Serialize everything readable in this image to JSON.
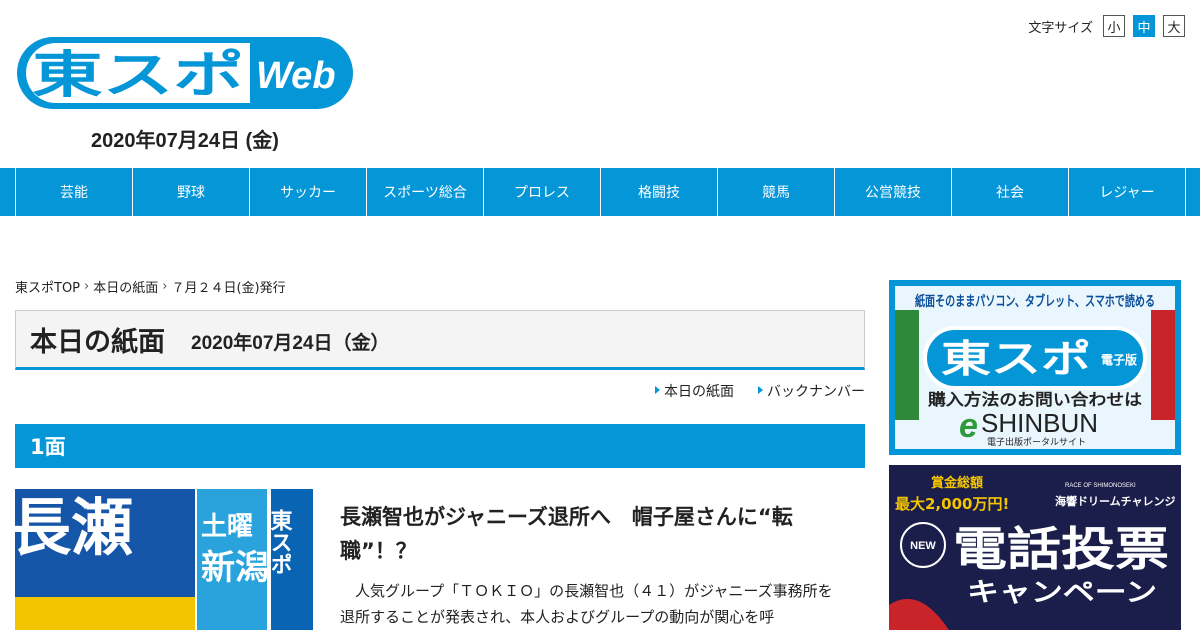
{
  "header": {
    "logo_main": "東スポ",
    "logo_sub": "Web",
    "date": "2020年07月24日 (金)",
    "font_size": {
      "label": "文字サイズ",
      "options": [
        "小",
        "中",
        "大"
      ],
      "selected": "中"
    }
  },
  "nav": {
    "items": [
      "芸能",
      "野球",
      "サッカー",
      "スポーツ総合",
      "プロレス",
      "格闘技",
      "競馬",
      "公営競技",
      "社会",
      "レジャー"
    ]
  },
  "breadcrumb": [
    "東スポTOP",
    "本日の紙面",
    "７月２４日(金)発行"
  ],
  "page": {
    "title": "本日の紙面",
    "date": "2020年07月24日（金）"
  },
  "subnav": [
    "本日の紙面",
    "バックナンバー"
  ],
  "section": {
    "label": "1面",
    "thumbnail_text": [
      "長瀬",
      "土曜",
      "新潟",
      "東スポ"
    ],
    "article_title": "長瀬智也がジャニーズ退所へ　帽子屋さんに“転職”！？",
    "article_body": "人気グループ「ＴＯＫＩＯ」の長瀬智也（４１）がジャニーズ事務所を退所することが発表され、本人およびグループの動向が関心を呼"
  },
  "ads": {
    "ad1": {
      "top": "紙面そのままパソコン、タブレット、スマホで読める",
      "logo": "東スポ",
      "logo_tag": "電子版",
      "line": "購入方法のお問い合わせは",
      "brand": "SHINBUN",
      "brand_e": "e",
      "sub": "電子出版ポータルサイト"
    },
    "ad2": {
      "prize_label": "賞金総額",
      "prize": "最大2,000万円!",
      "race": "RACE OF SHIMONOSEKI",
      "race_name": "海響ドリームチャレンジ",
      "badge": "NEW",
      "title": "電話投票",
      "title2": "キャンペーン"
    }
  },
  "colors": {
    "brand_blue": "#0596d8",
    "ad_dark": "#1b1d4a"
  }
}
